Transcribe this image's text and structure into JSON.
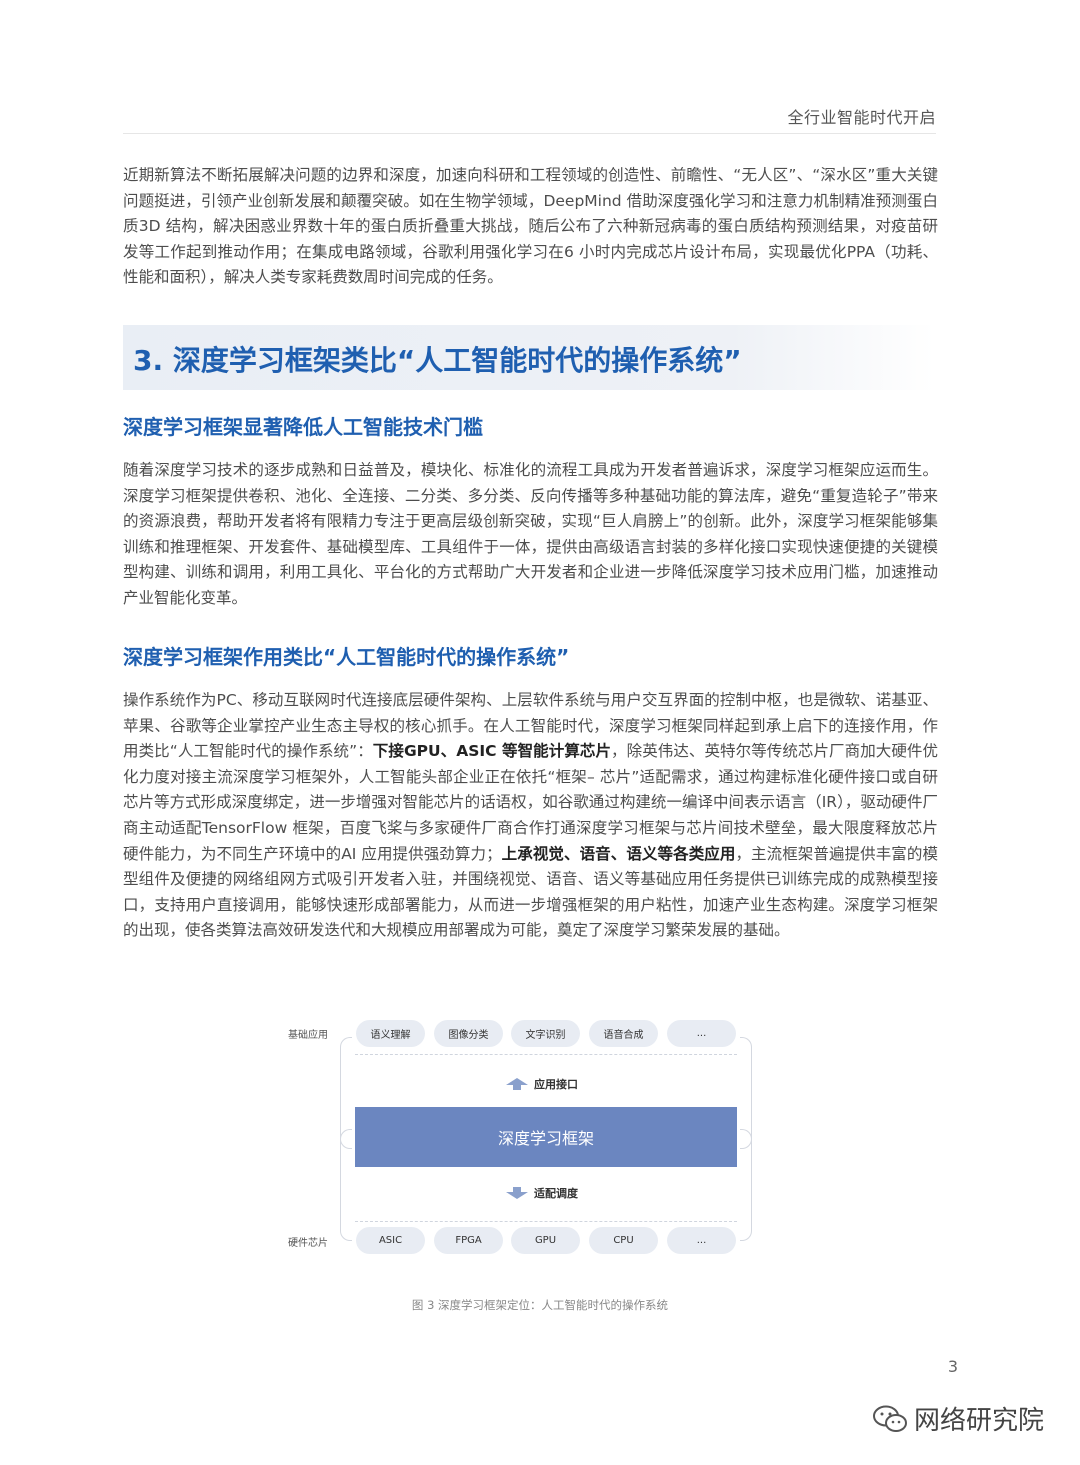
{
  "header": {
    "title": "全行业智能时代开启"
  },
  "intro_paragraph": "近期新算法不断拓展解决问题的边界和深度，加速向科研和工程领域的创造性、前瞻性、“无人区”、“深水区”重大关键问题挺进，引领产业创新发展和颠覆突破。如在生物学领域，DeepMind 借助深度强化学习和注意力机制精准预测蛋白质3D 结构，解决困惑业界数十年的蛋白质折叠重大挑战，随后公布了六种新冠病毒的蛋白质结构预测结果，对疫苗研发等工作起到推动作用；在集成电路领域，谷歌利用强化学习在6 小时内完成芯片设计布局，实现最优化PPA（功耗、性能和面积），解决人类专家耗费数周时间完成的任务。",
  "section": {
    "title": "3. 深度学习框架类比“人工智能时代的操作系统”"
  },
  "subsection1": {
    "heading": "深度学习框架显著降低人工智能技术门槛",
    "paragraph": "随着深度学习技术的逐步成熟和日益普及，模块化、标准化的流程工具成为开发者普遍诉求，深度学习框架应运而生。深度学习框架提供卷积、池化、全连接、二分类、多分类、反向传播等多种基础功能的算法库，避免“重复造轮子”带来的资源浪费，帮助开发者将有限精力专注于更高层级创新突破，实现“巨人肩膀上”的创新。此外，深度学习框架能够集训练和推理框架、开发套件、基础模型库、工具组件于一体，提供由高级语言封装的多样化接口实现快速便捷的关键模型构建、训练和调用，利用工具化、平台化的方式帮助广大开发者和企业进一步降低深度学习技术应用门槛，加速推动产业智能化变革。"
  },
  "subsection2": {
    "heading": "深度学习框架作用类比“人工智能时代的操作系统”",
    "p_part1": "操作系统作为PC、移动互联网时代连接底层硬件架构、上层软件系统与用户交互界面的控制中枢，也是微软、诺基亚、苹果、谷歌等企业掌控产业生态主导权的核心抓手。在人工智能时代，深度学习框架同样起到承上启下的连接作用，作用类比“人工智能时代的操作系统”：",
    "p_bold1": "下接GPU、ASIC 等智能计算芯片",
    "p_part2": "，除英伟达、英特尔等传统芯片厂商加大硬件优化力度对接主流深度学习框架外，人工智能头部企业正在依托“框架– 芯片”适配需求，通过构建标准化硬件接口或自研芯片等方式形成深度绑定，进一步增强对智能芯片的话语权，如谷歌通过构建统一编译中间表示语言（IR），驱动硬件厂商主动适配TensorFlow 框架，百度飞桨与多家硬件厂商合作打通深度学习框架与芯片间技术壁垒，最大限度释放芯片硬件能力，为不同生产环境中的AI 应用提供强劲算力；",
    "p_bold2": "上承视觉、语音、语义等各类应用",
    "p_part3": "，主流框架普遍提供丰富的模型组件及便捷的网络组网方式吸引开发者入驻，并围绕视觉、语音、语义等基础应用任务提供已训练完成的成熟模型接口，支持用户直接调用，能够快速形成部署能力，从而进一步增强框架的用户粘性，加速产业生态构建。深度学习框架的出现，使各类算法高效研发迭代和大规模应用部署成为可能，奠定了深度学习繁荣发展的基础。"
  },
  "diagram": {
    "top_label": "基础应用",
    "top_items": [
      "语义理解",
      "图像分类",
      "文字识别",
      "语音合成",
      "..."
    ],
    "up_arrow_label": "应用接口",
    "core_label": "深度学习框架",
    "down_arrow_label": "适配调度",
    "bottom_label": "硬件芯片",
    "bottom_items": [
      "ASIC",
      "FPGA",
      "GPU",
      "CPU",
      "..."
    ],
    "colors": {
      "core": "#6b86c0",
      "pill": "#e8ecf3",
      "arrow": "#8aa0cc"
    }
  },
  "figure_caption": "图 3 深度学习框架定位：人工智能时代的操作系统",
  "page_number": "3",
  "watermark": {
    "text": "网络研究院",
    "icon": "wechat-icon"
  }
}
